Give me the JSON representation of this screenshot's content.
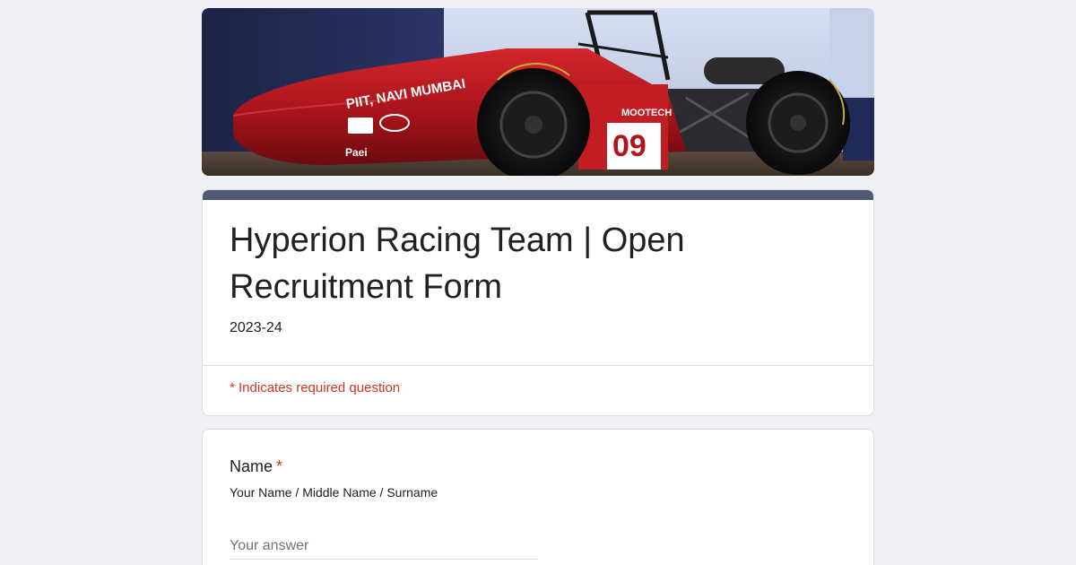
{
  "banner": {
    "car_text": "PIIT, NAVI MUMBAI",
    "car_number": "09",
    "sponsor_text": "MOOTECH",
    "sponsor_small": "Paei"
  },
  "form": {
    "title": "Hyperion Racing Team | Open Recruitment Form",
    "description": "2023-24",
    "required_note": "* Indicates required question"
  },
  "questions": [
    {
      "label": "Name",
      "required_marker": "*",
      "help": "Your Name / Middle Name / Surname",
      "placeholder": "Your answer",
      "value": ""
    }
  ],
  "colors": {
    "background": "#eff0f5",
    "accent": "#4f5875",
    "required": "#d93025",
    "car_red": "#b3141c"
  }
}
